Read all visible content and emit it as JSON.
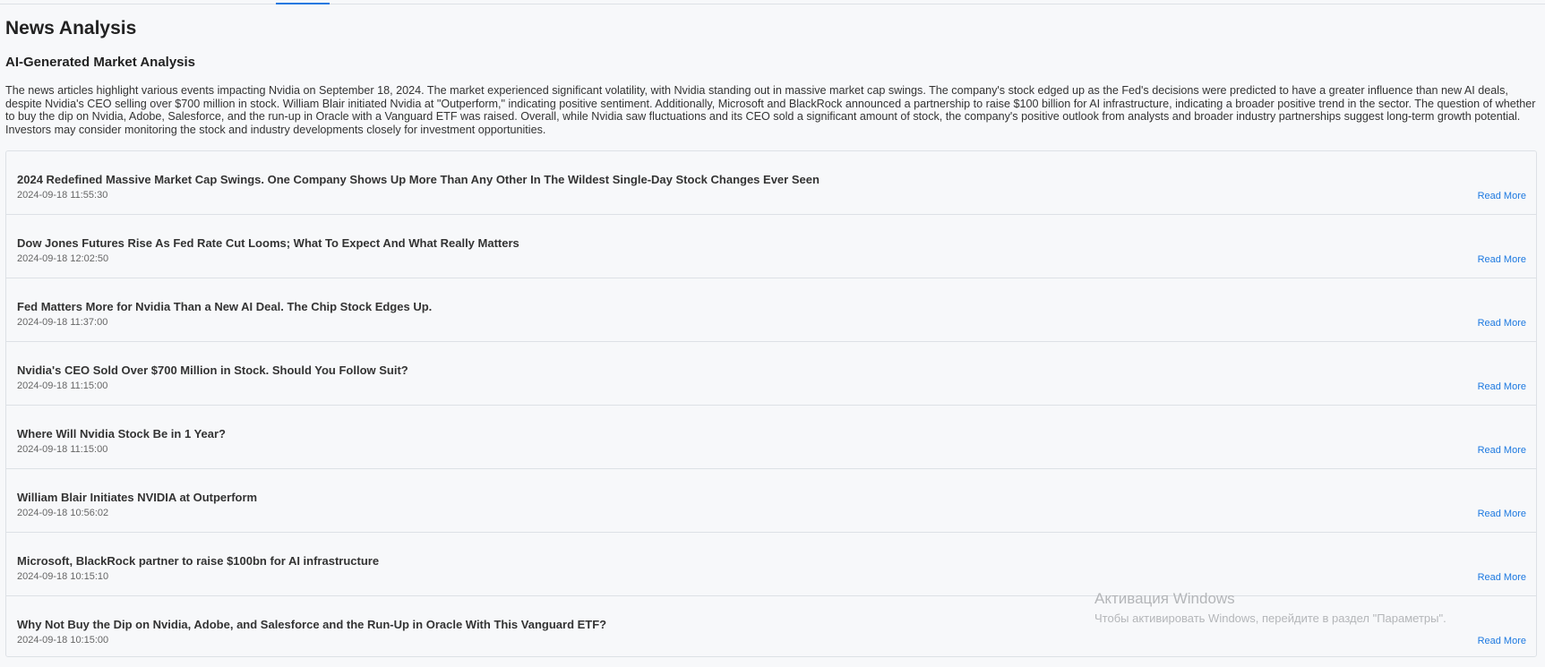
{
  "page": {
    "title": "News Analysis",
    "section_title": "AI-Generated Market Analysis",
    "analysis_text": "The news articles highlight various events impacting Nvidia on September 18, 2024. The market experienced significant volatility, with Nvidia standing out in massive market cap swings. The company's stock edged up as the Fed's decisions were predicted to have a greater influence than new AI deals, despite Nvidia's CEO selling over $700 million in stock. William Blair initiated Nvidia at \"Outperform,\" indicating positive sentiment. Additionally, Microsoft and BlackRock announced a partnership to raise $100 billion for AI infrastructure, indicating a broader positive trend in the sector. The question of whether to buy the dip on Nvidia, Adobe, Salesforce, and the run-up in Oracle with a Vanguard ETF was raised. Overall, while Nvidia saw fluctuations and its CEO sold a significant amount of stock, the company's positive outlook from analysts and broader industry partnerships suggest long-term growth potential. Investors may consider monitoring the stock and industry developments closely for investment opportunities."
  },
  "news": {
    "read_more_label": "Read More",
    "items": [
      {
        "headline": "2024 Redefined Massive Market Cap Swings. One Company Shows Up More Than Any Other In The Wildest Single-Day Stock Changes Ever Seen",
        "timestamp": "2024-09-18 11:55:30"
      },
      {
        "headline": "Dow Jones Futures Rise As Fed Rate Cut Looms; What To Expect And What Really Matters",
        "timestamp": "2024-09-18 12:02:50"
      },
      {
        "headline": "Fed Matters More for Nvidia Than a New AI Deal. The Chip Stock Edges Up.",
        "timestamp": "2024-09-18 11:37:00"
      },
      {
        "headline": "Nvidia's CEO Sold Over $700 Million in Stock. Should You Follow Suit?",
        "timestamp": "2024-09-18 11:15:00"
      },
      {
        "headline": "Where Will Nvidia Stock Be in 1 Year?",
        "timestamp": "2024-09-18 11:15:00"
      },
      {
        "headline": "William Blair Initiates NVIDIA at Outperform",
        "timestamp": "2024-09-18 10:56:02"
      },
      {
        "headline": "Microsoft, BlackRock partner to raise $100bn for AI infrastructure",
        "timestamp": "2024-09-18 10:15:10"
      },
      {
        "headline": "Why Not Buy the Dip on Nvidia, Adobe, and Salesforce and the Run-Up in Oracle With This Vanguard ETF?",
        "timestamp": "2024-09-18 10:15:00"
      }
    ]
  },
  "watermark": {
    "title": "Активация Windows",
    "subtitle": "Чтобы активировать Windows, перейдите в раздел \"Параметры\"."
  },
  "colors": {
    "accent": "#1d79e0",
    "background": "#f7f8fa",
    "border": "#dde1e6"
  }
}
